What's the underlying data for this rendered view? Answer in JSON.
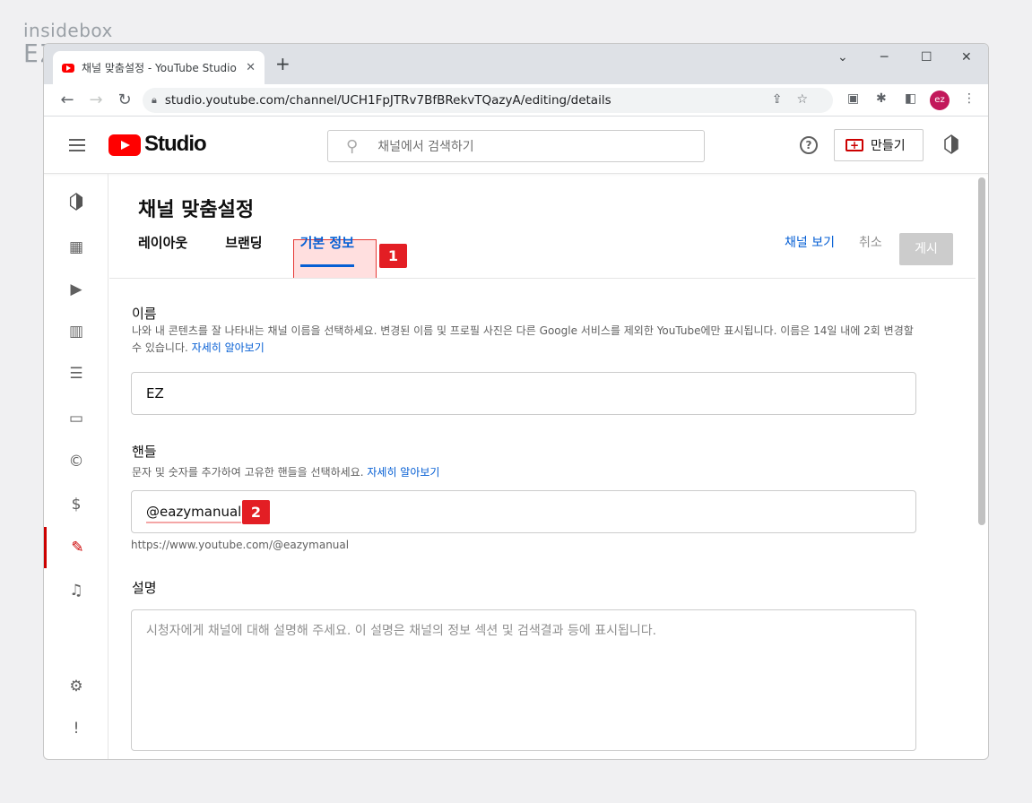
{
  "watermark": {
    "line1": "insidebox",
    "line2": "EZmanual"
  },
  "browser": {
    "tab_title": "채널 맞춤설정 - YouTube Studio",
    "tab_close": "✕",
    "new_tab": "+",
    "url": "studio.youtube.com/channel/UCH1FpJTRv7BfBRekvTQazyA/editing/details",
    "avatar_text": "ez"
  },
  "header": {
    "logo_text": "Studio",
    "search_placeholder": "채널에서 검색하기",
    "create_label": "만들기",
    "help": "?"
  },
  "page": {
    "title": "채널 맞춤설정",
    "tabs": [
      "레이아웃",
      "브랜딩",
      "기본 정보"
    ],
    "view_channel": "채널 보기",
    "cancel": "취소",
    "publish": "게시",
    "badge1": "1",
    "badge2": "2"
  },
  "name_section": {
    "title": "이름",
    "desc": "나와 내 콘텐츠를 잘 나타내는 채널 이름을 선택하세요. 변경된 이름 및 프로필 사진은 다른 Google 서비스를 제외한 YouTube에만 표시됩니다. 이름은 14일 내에 2회 변경할 수 있습니다.",
    "link": "자세히 알아보기",
    "value": "EZ"
  },
  "handle_section": {
    "title": "핸들",
    "desc": "문자 및 숫자를 추가하여 고유한 핸들을 선택하세요.",
    "link": "자세히 알아보기",
    "value": "@eazymanual",
    "url": "https://www.youtube.com/@eazymanual"
  },
  "description_section": {
    "title": "설명",
    "placeholder": "시청자에게 채널에 대해 설명해 주세요. 이 설명은 채널의 정보 섹션 및 검색결과 등에 표시됩니다."
  },
  "sidebar_icons": [
    "channel-avatar-icon",
    "dashboard-icon",
    "content-icon",
    "analytics-icon",
    "comments-icon",
    "subtitles-icon",
    "copyright-icon",
    "earn-icon",
    "customization-icon",
    "audio-library-icon",
    "settings-icon",
    "feedback-icon"
  ]
}
